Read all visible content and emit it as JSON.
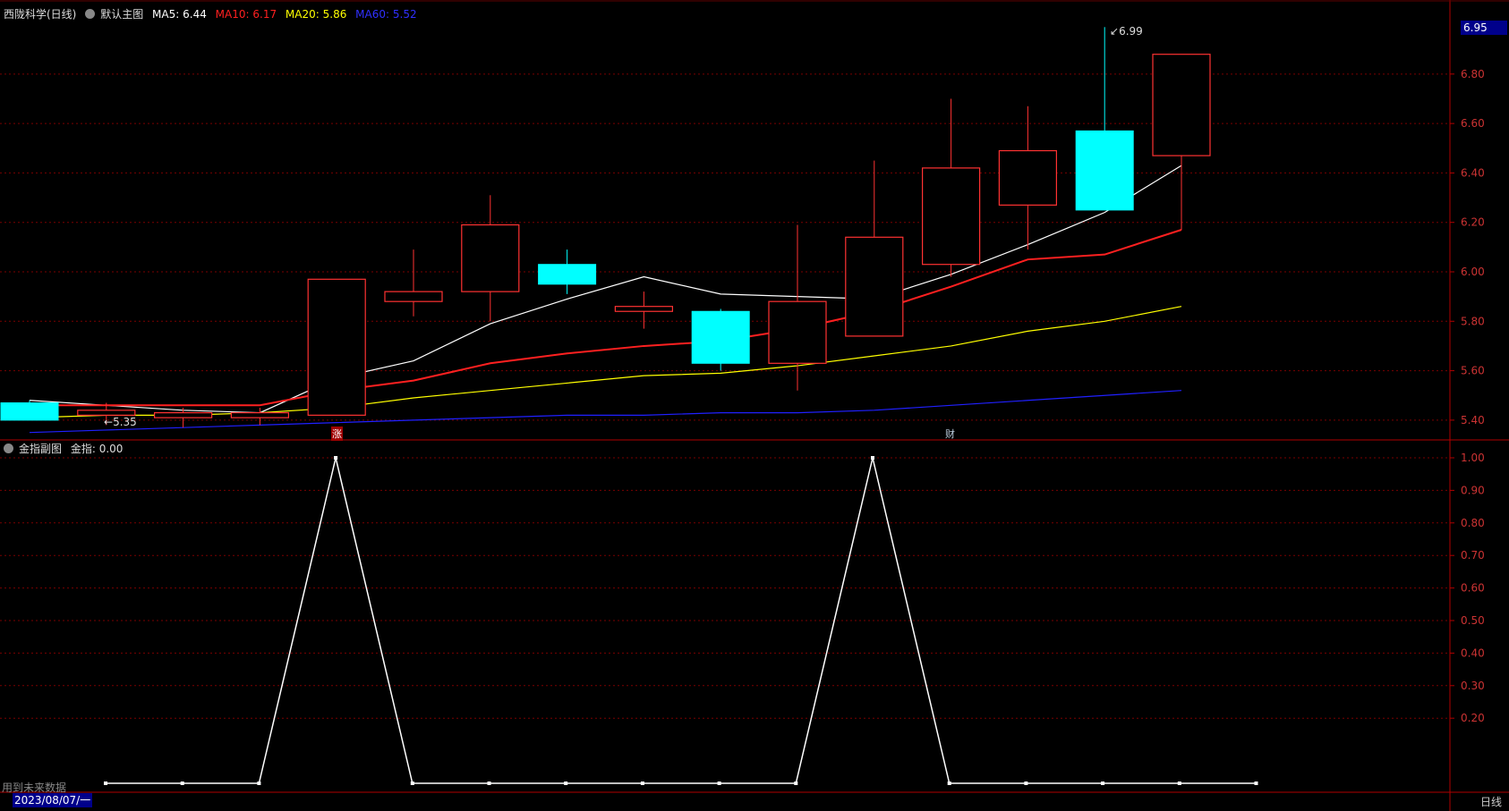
{
  "header": {
    "stock_name": "西陇科学(日线)",
    "template_label": "默认主图",
    "ma5": {
      "label": "MA5:",
      "value": "6.44",
      "color": "#ffffff"
    },
    "ma10": {
      "label": "MA10:",
      "value": "6.17",
      "color": "#ff2020"
    },
    "ma20": {
      "label": "MA20:",
      "value": "5.86",
      "color": "#ffff00"
    },
    "ma60": {
      "label": "MA60:",
      "value": "5.52",
      "color": "#2020ff"
    }
  },
  "sub_header": {
    "title": "金指副图",
    "value_label": "金指:",
    "value": "0.00"
  },
  "current_price": "6.95",
  "markers": {
    "zhang": "涨",
    "cai": "财"
  },
  "high_label": "6.99",
  "low_label": "5.35",
  "footer": {
    "date": "2023/08/07/一",
    "period": "日线",
    "note": "用到未来数据"
  },
  "colors": {
    "up": "#ff3232",
    "down": "#00ffff",
    "grid": "#7a0000",
    "axis_text": "#cc3333"
  },
  "chart_data": [
    {
      "type": "candlestick",
      "title": "西陇科学(日线)",
      "ylim": [
        5.32,
        7.02
      ],
      "y_ticks": [
        5.4,
        5.6,
        5.8,
        6.0,
        6.2,
        6.4,
        6.6,
        6.8
      ],
      "candles": [
        {
          "o": 5.47,
          "h": 5.48,
          "l": 5.4,
          "c": 5.4
        },
        {
          "o": 5.42,
          "h": 5.47,
          "l": 5.38,
          "c": 5.44
        },
        {
          "o": 5.41,
          "h": 5.45,
          "l": 5.37,
          "c": 5.43
        },
        {
          "o": 5.41,
          "h": 5.45,
          "l": 5.38,
          "c": 5.43
        },
        {
          "o": 5.42,
          "h": 5.97,
          "l": 5.42,
          "c": 5.97
        },
        {
          "o": 5.88,
          "h": 6.09,
          "l": 5.82,
          "c": 5.92
        },
        {
          "o": 5.92,
          "h": 6.31,
          "l": 5.8,
          "c": 6.19
        },
        {
          "o": 6.03,
          "h": 6.09,
          "l": 5.91,
          "c": 5.95
        },
        {
          "o": 5.84,
          "h": 5.92,
          "l": 5.77,
          "c": 5.86
        },
        {
          "o": 5.84,
          "h": 5.85,
          "l": 5.6,
          "c": 5.63
        },
        {
          "o": 5.63,
          "h": 6.19,
          "l": 5.52,
          "c": 5.88
        },
        {
          "o": 5.74,
          "h": 6.45,
          "l": 5.74,
          "c": 6.14
        },
        {
          "o": 6.03,
          "h": 6.7,
          "l": 5.98,
          "c": 6.42
        },
        {
          "o": 6.27,
          "h": 6.67,
          "l": 6.09,
          "c": 6.49
        },
        {
          "o": 6.57,
          "h": 6.99,
          "l": 6.25,
          "c": 6.25
        },
        {
          "o": 6.47,
          "h": 6.88,
          "l": 6.17,
          "c": 6.88
        }
      ],
      "ma": [
        {
          "name": "MA5",
          "color": "#ffffff",
          "values": [
            5.48,
            5.46,
            5.44,
            5.43,
            5.57,
            5.64,
            5.79,
            5.89,
            5.98,
            5.91,
            5.9,
            5.89,
            5.99,
            6.11,
            6.24,
            6.43
          ]
        },
        {
          "name": "MA10",
          "color": "#ff2020",
          "values": [
            5.46,
            5.46,
            5.46,
            5.46,
            5.52,
            5.56,
            5.63,
            5.67,
            5.7,
            5.72,
            5.77,
            5.84,
            5.94,
            6.05,
            6.07,
            6.17
          ]
        },
        {
          "name": "MA20",
          "color": "#ffff00",
          "values": [
            5.41,
            5.42,
            5.42,
            5.43,
            5.45,
            5.49,
            5.52,
            5.55,
            5.58,
            5.59,
            5.62,
            5.66,
            5.7,
            5.76,
            5.8,
            5.86
          ]
        },
        {
          "name": "MA60",
          "color": "#2020ff",
          "values": [
            5.35,
            5.36,
            5.37,
            5.38,
            5.39,
            5.4,
            5.41,
            5.42,
            5.42,
            5.43,
            5.43,
            5.44,
            5.46,
            5.48,
            5.5,
            5.52
          ]
        }
      ]
    },
    {
      "type": "line",
      "title": "金指副图",
      "ylim": [
        0,
        1.0
      ],
      "y_ticks": [
        0.2,
        0.3,
        0.4,
        0.5,
        0.6,
        0.7,
        0.8,
        0.9,
        1.0
      ],
      "series": [
        {
          "name": "金指",
          "color": "#ffffff",
          "values": [
            0,
            0,
            0,
            1,
            0,
            0,
            0,
            0,
            0,
            0,
            1,
            0,
            0,
            0,
            0,
            0
          ]
        }
      ]
    }
  ]
}
